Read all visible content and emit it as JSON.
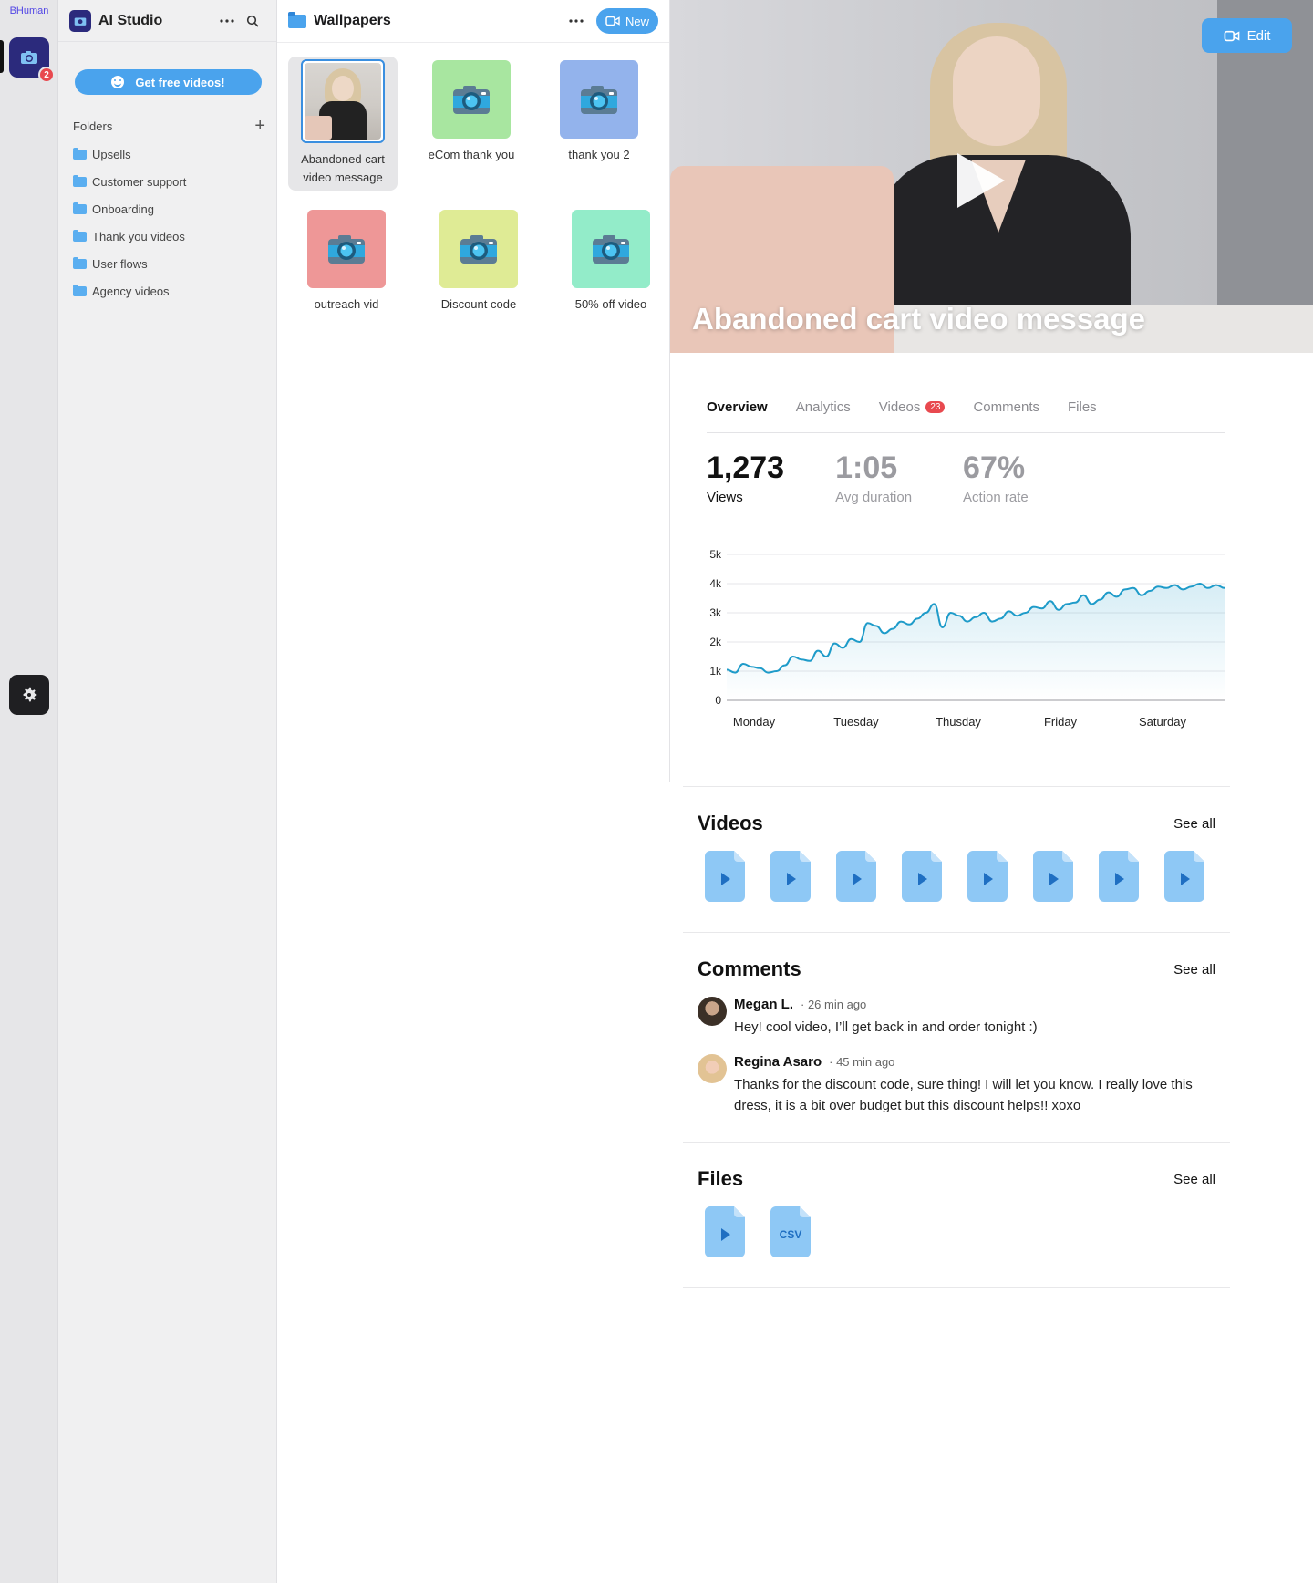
{
  "rail": {
    "brand": "BHuman",
    "notification_count": "2"
  },
  "sidebar": {
    "app_title": "AI Studio",
    "cta_label": "Get free videos!",
    "folders_label": "Folders",
    "folders": [
      "Upsells",
      "Customer support",
      "Onboarding",
      "Thank you videos",
      "User flows",
      "Agency videos"
    ]
  },
  "middle": {
    "title": "Wallpapers",
    "new_label": "New",
    "tiles": [
      {
        "label": "Abandoned cart video message",
        "color": "#ffffff",
        "selected": true
      },
      {
        "label": "eCom thank you",
        "color": "#a8e6a0"
      },
      {
        "label": "thank you 2",
        "color": "#93b3ec"
      },
      {
        "label": "outreach vid",
        "color": "#ee9797"
      },
      {
        "label": "Discount code",
        "color": "#dfeb95"
      },
      {
        "label": "50% off video",
        "color": "#93ecc9"
      }
    ]
  },
  "detail": {
    "hero_title": "Abandoned cart video message",
    "edit_label": "Edit",
    "tabs": [
      {
        "label": "Overview",
        "active": true
      },
      {
        "label": "Analytics"
      },
      {
        "label": "Videos",
        "badge": "23"
      },
      {
        "label": "Comments"
      },
      {
        "label": "Files"
      }
    ],
    "stats": [
      {
        "value": "1,273",
        "label": "Views"
      },
      {
        "value": "1:05",
        "label": "Avg duration"
      },
      {
        "value": "67%",
        "label": "Action rate"
      }
    ],
    "videos_title": "Videos",
    "comments_title": "Comments",
    "files_title": "Files",
    "see_all": "See all",
    "comments": [
      {
        "name": "Megan L.",
        "time": "· 26 min ago",
        "text": "Hey! cool video, I’ll get back in and order tonight :)"
      },
      {
        "name": "Regina Asaro",
        "time": "· 45 min ago",
        "text": "Thanks for the discount code, sure thing! I will let you know. I really love this dress, it is a bit over budget but this discount helps!! xoxo"
      }
    ],
    "files": [
      "video",
      "CSV"
    ]
  },
  "chart_data": {
    "type": "area",
    "categories": [
      "Monday",
      "Tuesday",
      "Thusday",
      "Friday",
      "Saturday"
    ],
    "y_ticks": [
      "0",
      "1k",
      "2k",
      "3k",
      "4k",
      "5k"
    ],
    "ylim": [
      0,
      5000
    ],
    "grid": true,
    "color": "#1e9bc9",
    "x": [
      0,
      1,
      2,
      3,
      4,
      5,
      6,
      7,
      8,
      9,
      10,
      11,
      12,
      13,
      14,
      15,
      16,
      17,
      18,
      19,
      20,
      21,
      22,
      23,
      24,
      25,
      26,
      27,
      28,
      29,
      30,
      31,
      32,
      33,
      34,
      35,
      36,
      37,
      38,
      39,
      40,
      41,
      42,
      43,
      44,
      45,
      46,
      47,
      48,
      49,
      50,
      51,
      52,
      53,
      54,
      55,
      56,
      57,
      58,
      59,
      60
    ],
    "values": [
      1050,
      950,
      1250,
      1150,
      1100,
      950,
      1000,
      1200,
      1500,
      1400,
      1350,
      1700,
      1500,
      1950,
      1800,
      2100,
      2000,
      2650,
      2550,
      2300,
      2450,
      2700,
      2600,
      2800,
      3000,
      3300,
      2500,
      3000,
      2900,
      2700,
      2850,
      3000,
      2700,
      2800,
      3050,
      2900,
      3000,
      3200,
      3150,
      3400,
      3100,
      3300,
      3350,
      3600,
      3300,
      3450,
      3700,
      3550,
      3800,
      3850,
      3600,
      3750,
      3900,
      3850,
      3950,
      3800,
      3900,
      4000,
      3850,
      3950,
      3850
    ]
  }
}
